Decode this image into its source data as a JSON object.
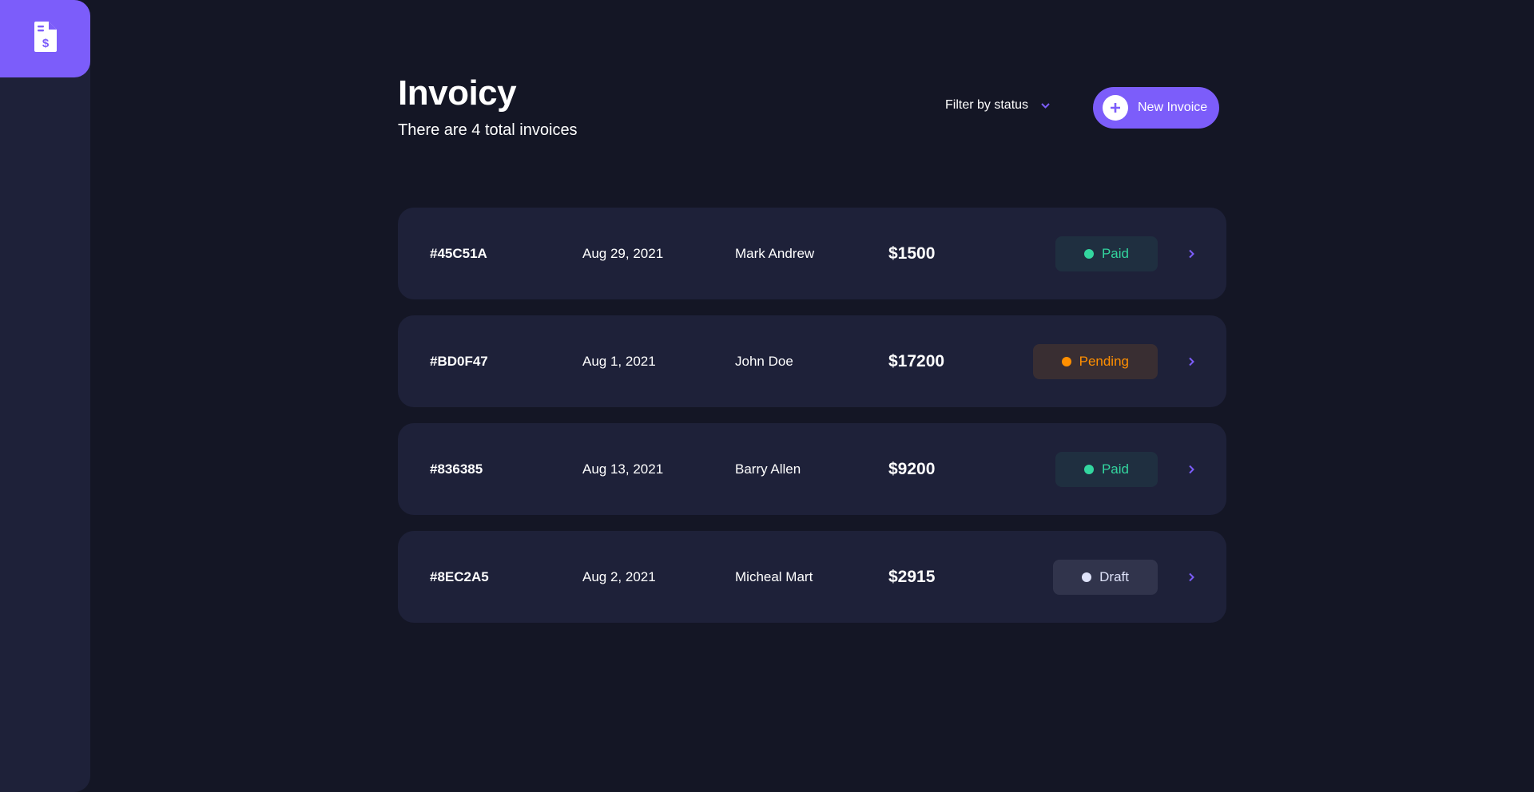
{
  "header": {
    "title": "Invoicy",
    "subtitle": "There are 4 total invoices",
    "filter_label": "Filter by status",
    "new_button_label": "New Invoice"
  },
  "colors": {
    "accent": "#7c5dfa",
    "paid": "#33d69f",
    "pending": "#ff8f00",
    "draft": "#dfe3fa"
  },
  "icons": {
    "logo": "invoice-dollar-icon",
    "filter": "chevron-down-icon",
    "new": "plus-icon",
    "row": "chevron-right-icon"
  },
  "invoices": [
    {
      "id": "#45C51A",
      "date": "Aug 29, 2021",
      "name": "Mark Andrew",
      "amount": "$1500",
      "status": "Paid"
    },
    {
      "id": "#BD0F47",
      "date": "Aug 1, 2021",
      "name": "John Doe",
      "amount": "$17200",
      "status": "Pending"
    },
    {
      "id": "#836385",
      "date": "Aug 13, 2021",
      "name": "Barry Allen",
      "amount": "$9200",
      "status": "Paid"
    },
    {
      "id": "#8EC2A5",
      "date": "Aug 2, 2021",
      "name": "Micheal Mart",
      "amount": "$2915",
      "status": "Draft"
    }
  ]
}
